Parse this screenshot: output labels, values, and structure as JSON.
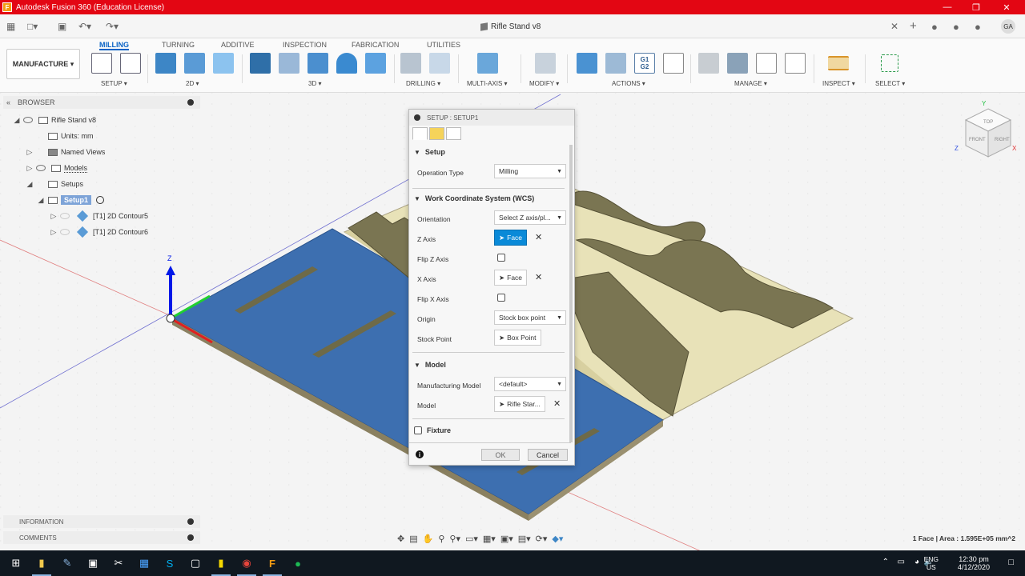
{
  "window": {
    "title": "Autodesk Fusion 360 (Education License)",
    "app_icon": "F",
    "user_initials": "GA"
  },
  "document": {
    "title": "Rifle Stand v8"
  },
  "workspace": {
    "label": "MANUFACTURE"
  },
  "ribbon": {
    "tabs": [
      {
        "label": "MILLING",
        "active": true
      },
      {
        "label": "TURNING"
      },
      {
        "label": "ADDITIVE"
      },
      {
        "label": "INSPECTION"
      },
      {
        "label": "FABRICATION"
      },
      {
        "label": "UTILITIES"
      }
    ],
    "groups": [
      "SETUP ▾",
      "2D ▾",
      "3D ▾",
      "DRILLING ▾",
      "MULTI-AXIS ▾",
      "MODIFY ▾",
      "ACTIONS ▾",
      "MANAGE ▾",
      "INSPECT ▾",
      "SELECT ▾"
    ],
    "accent": "#0b63c5"
  },
  "browser": {
    "header": "BROWSER",
    "items": [
      {
        "label": "Rifle Stand v8"
      },
      {
        "label": "Units: mm"
      },
      {
        "label": "Named Views"
      },
      {
        "label": "Models"
      },
      {
        "label": "Setups"
      },
      {
        "label": "Setup1"
      },
      {
        "label": "[T1] 2D Contour5"
      },
      {
        "label": "[T1] 2D Contour6"
      }
    ]
  },
  "dialog": {
    "title": "SETUP : SETUP1",
    "sections": {
      "setup": "Setup",
      "wcs": "Work Coordinate System (WCS)",
      "model": "Model",
      "fixture": "Fixture"
    },
    "fields": {
      "operation_type": {
        "label": "Operation Type",
        "value": "Milling"
      },
      "orientation": {
        "label": "Orientation",
        "value": "Select Z axis/pl..."
      },
      "z_axis": {
        "label": "Z Axis",
        "value": "Face"
      },
      "flip_z": {
        "label": "Flip Z Axis"
      },
      "x_axis": {
        "label": "X Axis",
        "value": "Face"
      },
      "flip_x": {
        "label": "Flip X Axis"
      },
      "origin": {
        "label": "Origin",
        "value": "Stock box point"
      },
      "stock_point": {
        "label": "Stock Point",
        "value": "Box Point"
      },
      "manufacturing_model": {
        "label": "Manufacturing Model",
        "value": "<default>"
      },
      "model": {
        "label": "Model",
        "value": "Rifle Star..."
      }
    },
    "ok": "OK",
    "cancel": "Cancel"
  },
  "panels": {
    "information": "INFORMATION",
    "comments": "COMMENTS"
  },
  "viewcube": {
    "top": "TOP",
    "front": "FRONT",
    "right": "RIGHT",
    "axis_x": "X",
    "axis_y": "Y",
    "axis_z": "Z"
  },
  "triad": {
    "z": "Z"
  },
  "status": {
    "selection": "1 Face | Area : 1.595E+05 mm^2"
  },
  "taskbar": {
    "lang_top": "ENG",
    "lang_bottom": "US",
    "time": "12:30 pm",
    "date": "4/12/2020"
  }
}
